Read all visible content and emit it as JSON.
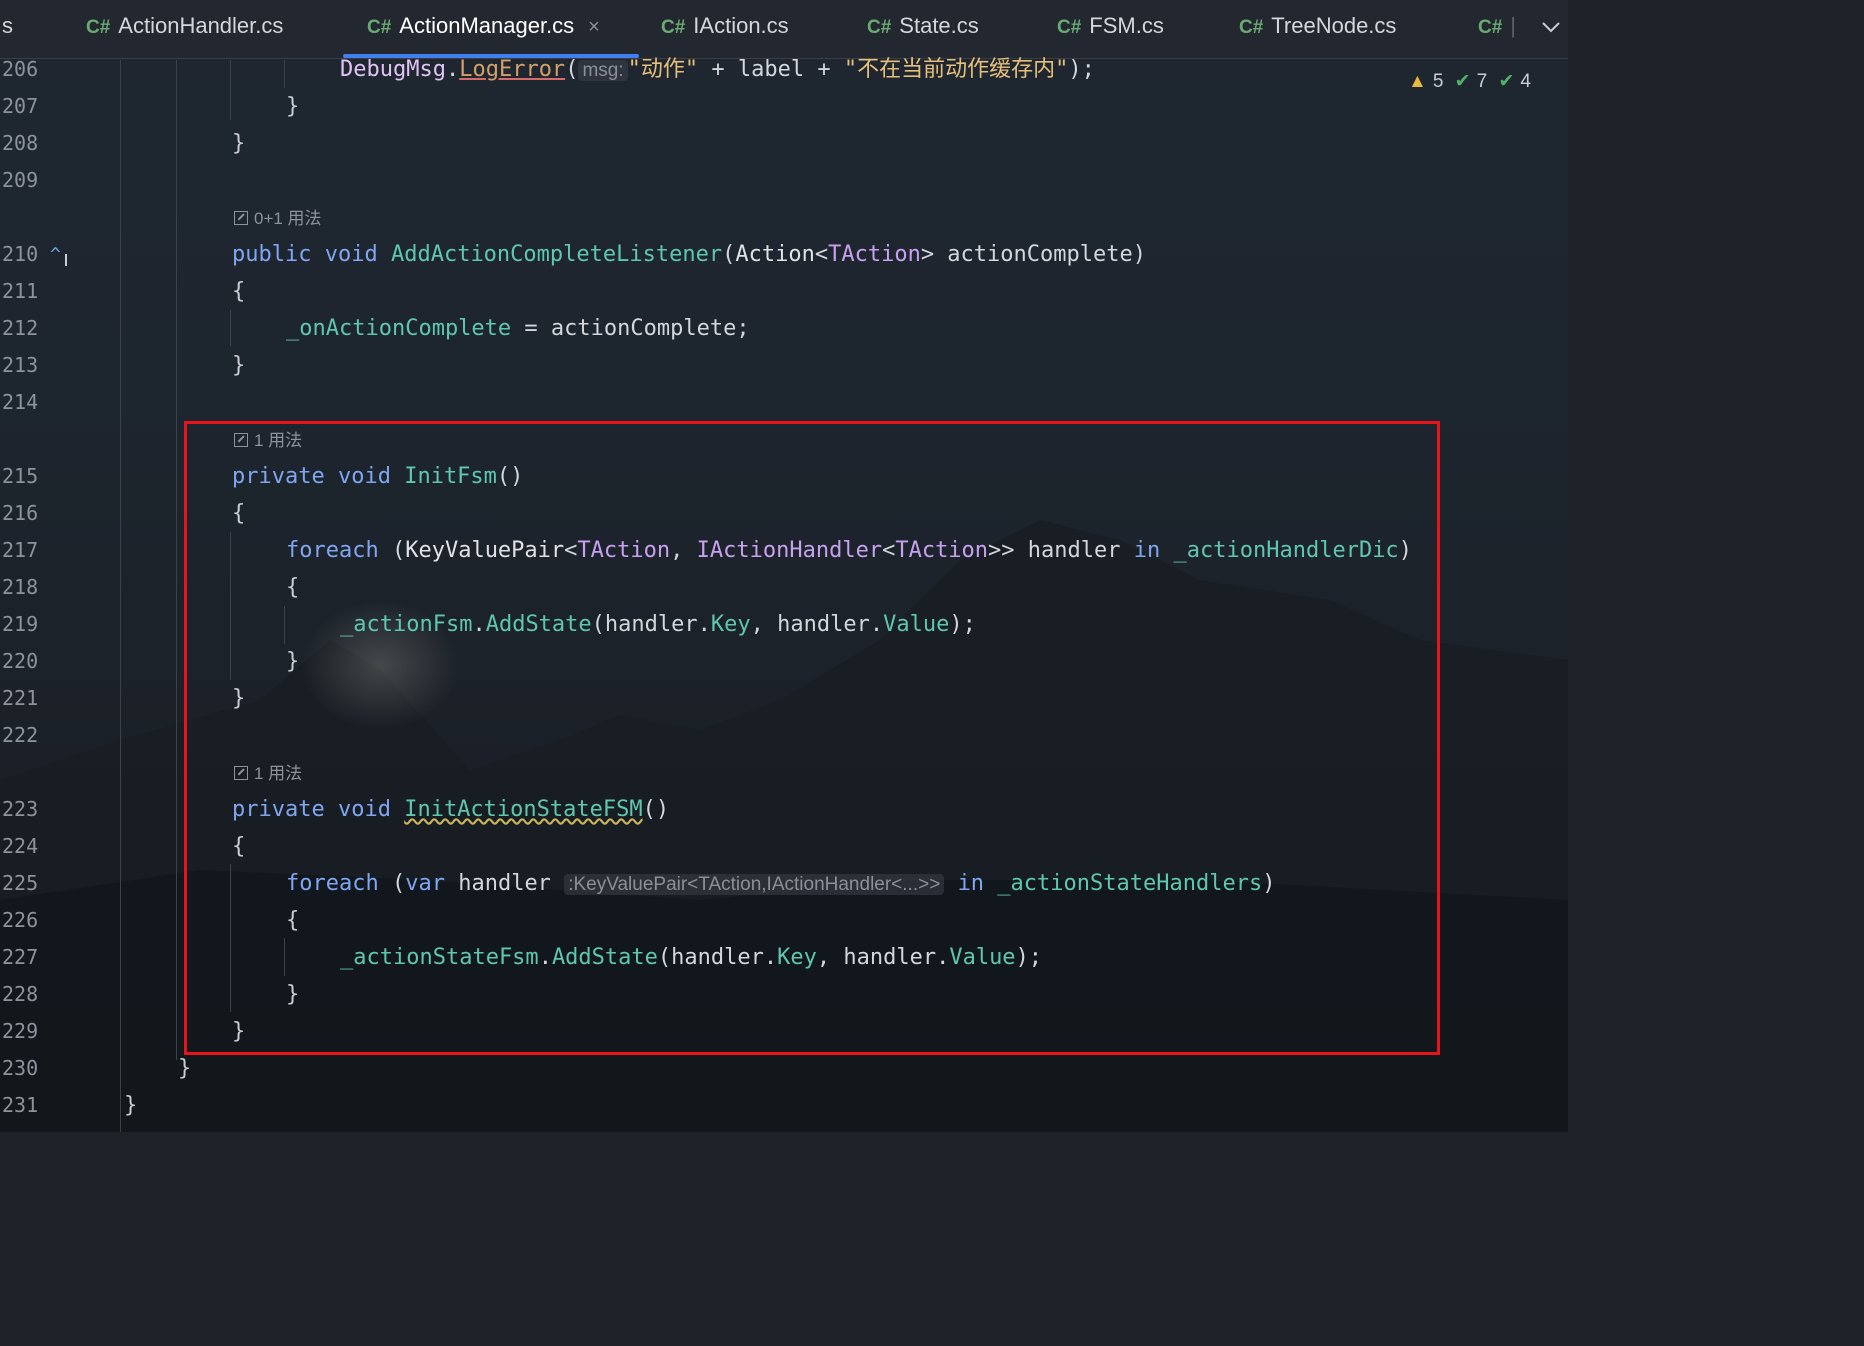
{
  "tabs": [
    {
      "lang": "",
      "label": "s",
      "active": false,
      "closable": false
    },
    {
      "lang": "C#",
      "label": "ActionHandler.cs",
      "active": false,
      "closable": false
    },
    {
      "lang": "C#",
      "label": "ActionManager.cs",
      "active": true,
      "closable": true
    },
    {
      "lang": "C#",
      "label": "IAction.cs",
      "active": false,
      "closable": false
    },
    {
      "lang": "C#",
      "label": "State.cs",
      "active": false,
      "closable": false
    },
    {
      "lang": "C#",
      "label": "FSM.cs",
      "active": false,
      "closable": false
    },
    {
      "lang": "C#",
      "label": "TreeNode.cs",
      "active": false,
      "closable": false
    },
    {
      "lang": "C#",
      "label": "",
      "active": false,
      "closable": false
    }
  ],
  "tab_close_glyph": "×",
  "inspection": {
    "warnings": "5",
    "weak_warnings": "7",
    "typos": "4"
  },
  "line_numbers": [
    "206",
    "207",
    "208",
    "209",
    "210",
    "211",
    "212",
    "213",
    "214",
    "215",
    "216",
    "217",
    "218",
    "219",
    "220",
    "221",
    "222",
    "223",
    "224",
    "225",
    "226",
    "227",
    "228",
    "229",
    "230",
    "231"
  ],
  "usages": [
    "0+1 用法",
    "1 用法",
    "1 用法"
  ],
  "code": {
    "l206": {
      "obj": "DebugMsg",
      "dot": ".",
      "method": "LogError",
      "open": "(",
      "hint": "msg:",
      "str1": "\"动作\"",
      "plus1": " + label + ",
      "str2": "\"不在当前动作缓存内\"",
      "close": ");"
    },
    "l207": "}",
    "l208": "}",
    "l210": {
      "kw1": "public",
      "kw2": "void",
      "name": "AddActionCompleteListener",
      "open": "(",
      "type": "Action",
      "lt": "<",
      "tparam": "TAction",
      "gt": ">",
      "param": " actionComplete",
      "close": ")"
    },
    "l211": "{",
    "l212": {
      "field": "_onActionComplete",
      "rest": " = actionComplete;"
    },
    "l213": "}",
    "l215": {
      "kw1": "private",
      "kw2": "void",
      "name": "InitFsm",
      "parens": "()"
    },
    "l216": "{",
    "l217": {
      "kw": "foreach",
      "open": " (",
      "type1": "KeyValuePair",
      "lt": "<",
      "tp1": "TAction",
      "comma": ", ",
      "type2": "IActionHandler",
      "lt2": "<",
      "tp2": "TAction",
      "gt": ">>",
      "var": " handler ",
      "in": "in",
      "field": " _actionHandlerDic",
      "close": ")"
    },
    "l218": "{",
    "l219": {
      "field": "_actionFsm",
      "dot": ".",
      "method": "AddState",
      "open": "(handler.",
      "p1": "Key",
      "mid": ", handler.",
      "p2": "Value",
      "close": ");"
    },
    "l220": "}",
    "l221": "}",
    "l223": {
      "kw1": "private",
      "kw2": "void",
      "name": "InitActionStateFSM",
      "parens": "()"
    },
    "l224": "{",
    "l225": {
      "kw": "foreach",
      "open": " (",
      "var": "var",
      "name": " handler ",
      "hint": ":KeyValuePair<TAction,IActionHandler<...>>",
      "in": "in",
      "field": " _actionStateHandlers",
      "close": ")"
    },
    "l226": "{",
    "l227": {
      "field": "_actionStateFsm",
      "dot": ".",
      "method": "AddState",
      "open": "(handler.",
      "p1": "Key",
      "mid": ", handler.",
      "p2": "Value",
      "close": ");"
    },
    "l228": "}",
    "l229": "}",
    "l230": "}",
    "l231": "}"
  },
  "colors": {
    "highlight_border": "#e8141c",
    "tab_underline": "#3f7ff0",
    "csharp_badge": "#6aab73"
  }
}
